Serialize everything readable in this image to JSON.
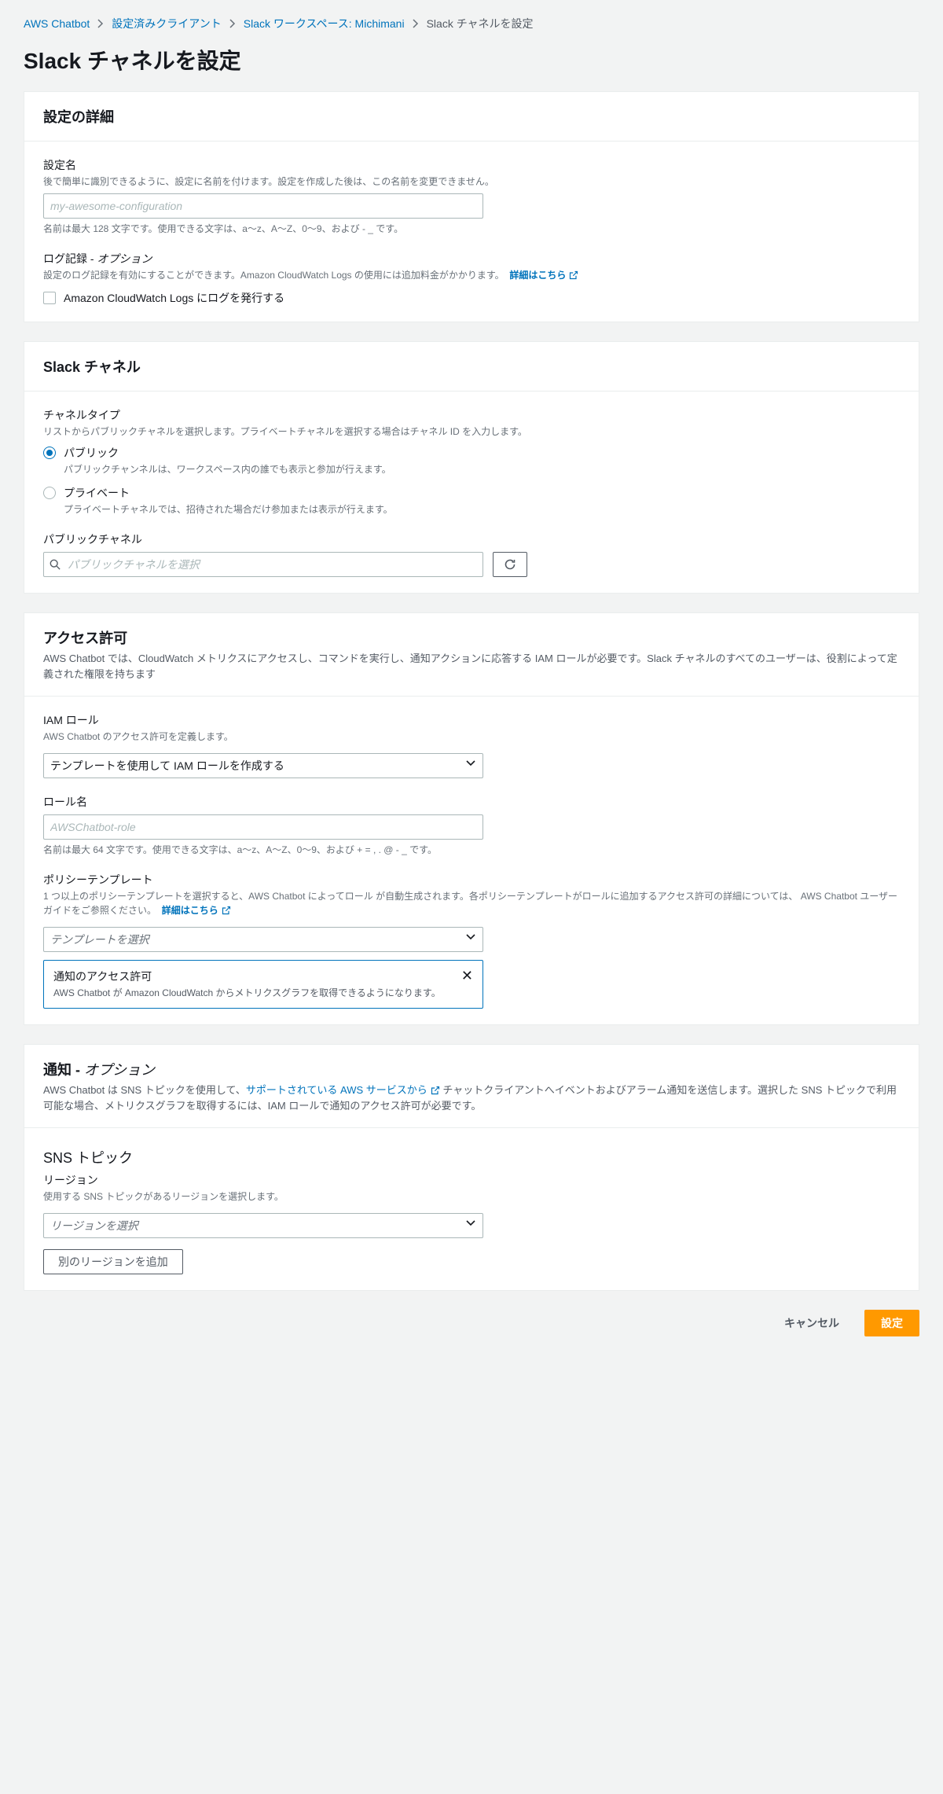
{
  "breadcrumb": {
    "items": [
      {
        "label": "AWS Chatbot"
      },
      {
        "label": "設定済みクライアント"
      },
      {
        "label": "Slack ワークスペース: Michimani"
      }
    ],
    "current": "Slack チャネルを設定"
  },
  "page_title": "Slack チャネルを設定",
  "details": {
    "title": "設定の詳細",
    "config_name": {
      "label": "設定名",
      "hint": "後で簡単に識別できるように、設定に名前を付けます。設定を作成した後は、この名前を変更できません。",
      "placeholder": "my-awesome-configuration",
      "help": "名前は最大 128 文字です。使用できる文字は、a〜z、A〜Z、0〜9、および - _ です。"
    },
    "logging": {
      "label": "ログ記録 - ",
      "optional": "オプション",
      "hint": "設定のログ記録を有効にすることができます。Amazon CloudWatch Logs の使用には追加料金がかかります。",
      "link": "詳細はこちら",
      "checkbox": "Amazon CloudWatch Logs にログを発行する"
    }
  },
  "slack": {
    "title": "Slack チャネル",
    "channel_type": {
      "label": "チャネルタイプ",
      "hint": "リストからパブリックチャネルを選択します。プライベートチャネルを選択する場合はチャネル ID を入力します。",
      "public": {
        "label": "パブリック",
        "hint": "パブリックチャンネルは、ワークスペース内の誰でも表示と参加が行えます。"
      },
      "private": {
        "label": "プライベート",
        "hint": "プライベートチャネルでは、招待された場合だけ参加または表示が行えます。"
      }
    },
    "public_channel": {
      "label": "パブリックチャネル",
      "placeholder": "パブリックチャネルを選択"
    }
  },
  "permissions": {
    "title": "アクセス許可",
    "desc": "AWS Chatbot では、CloudWatch メトリクスにアクセスし、コマンドを実行し、通知アクションに応答する IAM ロールが必要です。Slack チャネルのすべてのユーザーは、役割によって定義された権限を持ちます",
    "iam_role": {
      "label": "IAM ロール",
      "hint": "AWS Chatbot のアクセス許可を定義します。",
      "value": "テンプレートを使用して IAM ロールを作成する"
    },
    "role_name": {
      "label": "ロール名",
      "placeholder": "AWSChatbot-role",
      "help": "名前は最大 64 文字です。使用できる文字は、a〜z、A〜Z、0〜9、および + = , . @ - _ です。"
    },
    "policy": {
      "label": "ポリシーテンプレート",
      "hint": "1 つ以上のポリシーテンプレートを選択すると、AWS Chatbot によってロール が自動生成されます。各ポリシーテンプレートがロールに追加するアクセス許可の詳細については、 AWS Chatbot ユーザーガイドをご参照ください。",
      "link": "詳細はこちら",
      "placeholder": "テンプレートを選択",
      "tag": {
        "title": "通知のアクセス許可",
        "desc": "AWS Chatbot が Amazon CloudWatch からメトリクスグラフを取得できるようになります。"
      }
    }
  },
  "notifications": {
    "title_main": "通知 - ",
    "title_optional": "オプション",
    "desc_pre": "AWS Chatbot は SNS トピックを使用して、",
    "desc_link": "サポートされている AWS サービスから",
    "desc_post": " チャットクライアントへイベントおよびアラーム通知を送信します。選択した SNS トピックで利用可能な場合、メトリクスグラフを取得するには、IAM ロールで通知のアクセス許可が必要です。",
    "sns": {
      "title": "SNS トピック",
      "region_label": "リージョン",
      "region_hint": "使用する SNS トピックがあるリージョンを選択します。",
      "region_placeholder": "リージョンを選択",
      "add_button": "別のリージョンを追加"
    }
  },
  "footer": {
    "cancel": "キャンセル",
    "submit": "設定"
  }
}
